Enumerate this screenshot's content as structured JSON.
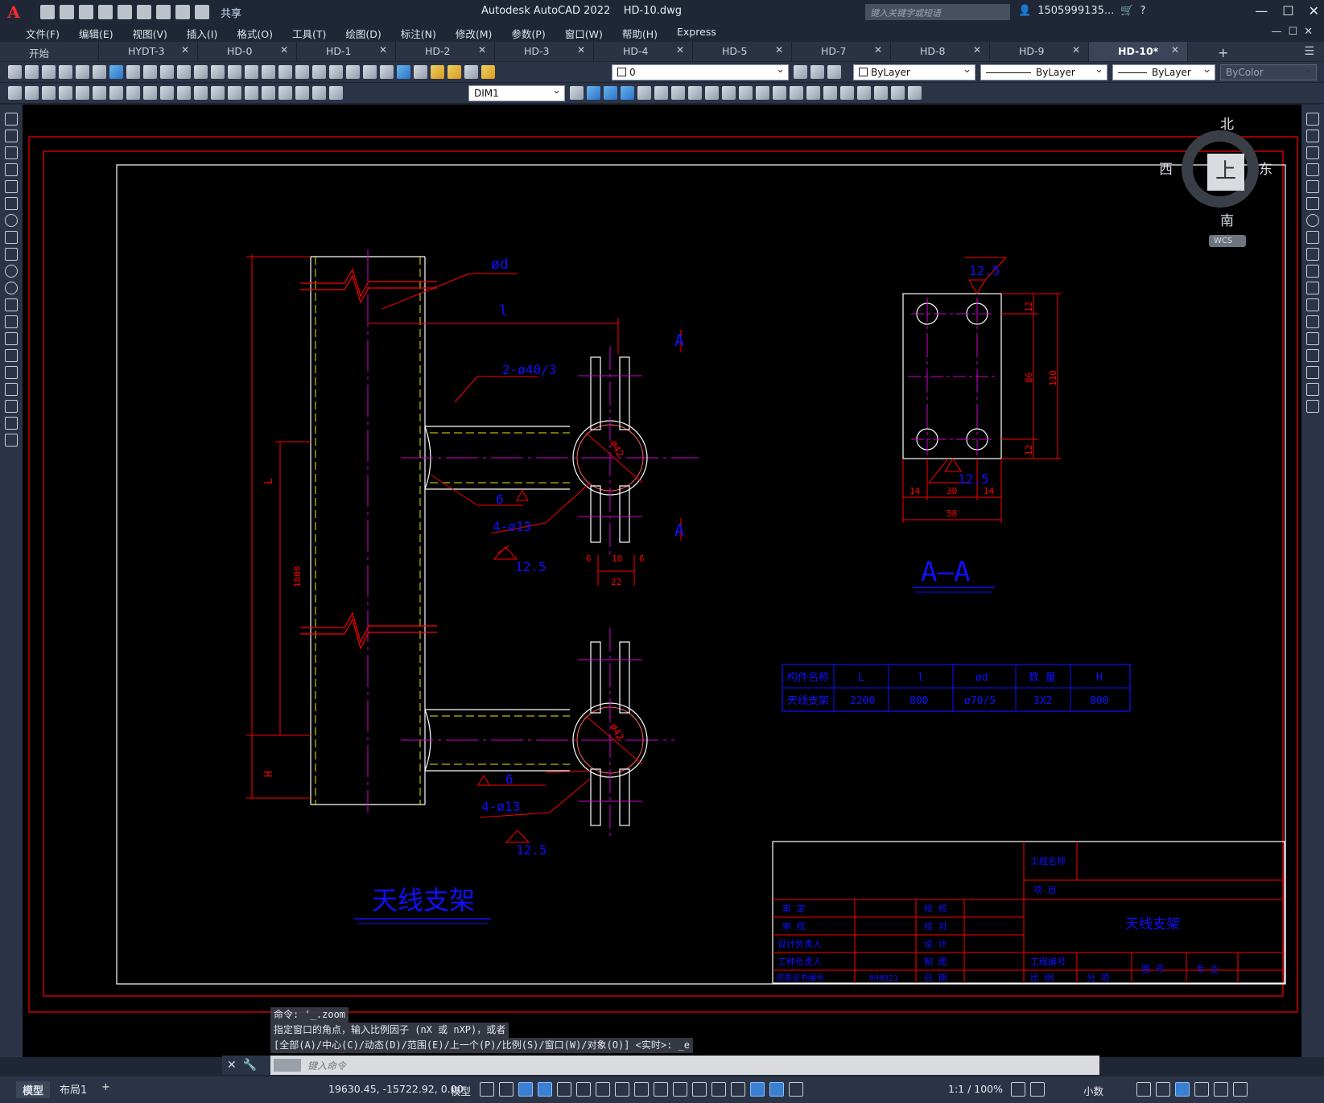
{
  "window": {
    "title": "Autodesk AutoCAD 2022    HD-10.dwg",
    "search_placeholder": "键入关键字或短语",
    "user": "1505999135...",
    "share_label": "共享"
  },
  "menu": [
    "文件(F)",
    "编辑(E)",
    "视图(V)",
    "插入(I)",
    "格式(O)",
    "工具(T)",
    "绘图(D)",
    "标注(N)",
    "修改(M)",
    "参数(P)",
    "窗口(W)",
    "帮助(H)",
    "Express"
  ],
  "doc_tabs": [
    "开始",
    "HYDT-3",
    "HD-0",
    "HD-1",
    "HD-2",
    "HD-3",
    "HD-4",
    "HD-5",
    "HD-7",
    "HD-8",
    "HD-9",
    "HD-10*"
  ],
  "active_tab": "HD-10*",
  "toolbar": {
    "layer_value": "0",
    "color_value": "ByLayer",
    "linetype_value": "ByLayer",
    "lineweight_value": "ByLayer",
    "plotstyle_value": "ByColor",
    "dimstyle_value": "DIM1"
  },
  "viewcube": {
    "top": "上",
    "north": "北",
    "south": "南",
    "east": "东",
    "west": "西",
    "wcs": "WCS"
  },
  "drawing": {
    "main_title": "天线支架",
    "section_title": "A—A",
    "section_mark": "A",
    "labels": {
      "od": "ød",
      "l": "l",
      "L": "L",
      "H": "H",
      "dim1000": "1000",
      "pipe": "2-ø40/3",
      "weld6": "6",
      "holes": "4-ø13",
      "rough": "12.5",
      "d42": "ø42",
      "d6a": "6",
      "d10": "10",
      "d6b": "6",
      "d22": "22"
    },
    "section_dims": {
      "top_rough": "12.5",
      "bottom_rough": "12.5",
      "d12a": "12",
      "d86": "86",
      "d12b": "12",
      "d110": "110",
      "d14a": "14",
      "d30": "30",
      "d14b": "14",
      "d58": "58"
    },
    "param_table": {
      "headers": [
        "构件名称",
        "L",
        "l",
        "ød",
        "数 量",
        "H"
      ],
      "row": [
        "天线支架",
        "2200",
        "800",
        "ø70/5",
        "3X2",
        "800"
      ]
    },
    "title_block": {
      "r1c1": "审 定",
      "r1c3": "校 核",
      "r2c1": "审 核",
      "r2c3": "校 对",
      "r3c1": "设计负责人",
      "r3c3": "设 计",
      "r4c1": "工种负责人",
      "r4c3": "制 图",
      "r5c1": "资质证书编号",
      "r5c2": "090021",
      "r5c3": "日 期",
      "project_name": "工程名称",
      "item": "项 目",
      "drawing_name": "天线支架",
      "proj_no": "工程编号",
      "scale": "比 例",
      "part": "分 项",
      "drawing_no": "图 号",
      "sheet": "专 业"
    }
  },
  "command": {
    "history": [
      "命令: '_.zoom",
      "指定窗口的角点，输入比例因子 (nX 或 nXP)，或者",
      "[全部(A)/中心(C)/动态(D)/范围(E)/上一个(P)/比例(S)/窗口(W)/对象(O)] <实时>: _e"
    ],
    "placeholder": "键入命令"
  },
  "status": {
    "layout_model": "模型",
    "layout_1": "布局1",
    "add_layout": "+",
    "coords": "19630.45, -15722.92, 0.00",
    "model_label": "模型",
    "scale": "1:1 / 100%",
    "units": "小数"
  },
  "colors": {
    "red": "#ff0000",
    "blue": "#1010ff",
    "yellow": "#e8e800",
    "magenta": "#d000d0",
    "white": "#ffffff"
  }
}
